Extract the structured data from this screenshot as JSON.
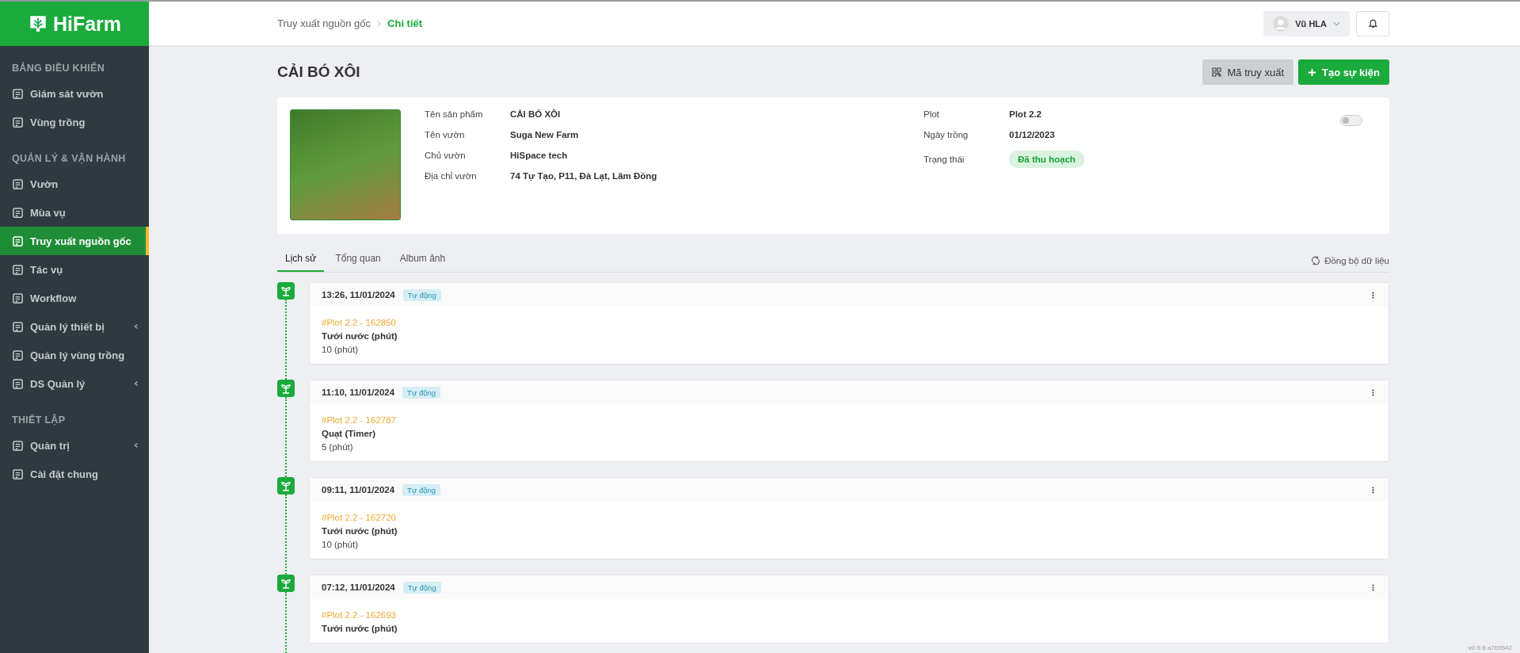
{
  "sidebar": {
    "logo": "HiFarm",
    "sections": [
      {
        "title": "BẢNG ĐIỀU KHIỂN",
        "items": [
          {
            "label": "Giám sát vườn",
            "selected": false,
            "expandable": false
          },
          {
            "label": "Vùng trồng",
            "selected": false,
            "expandable": false
          }
        ]
      },
      {
        "title": "QUẢN LÝ & VẬN HÀNH",
        "items": [
          {
            "label": "Vườn",
            "selected": false,
            "expandable": false
          },
          {
            "label": "Mùa vụ",
            "selected": false,
            "expandable": false
          },
          {
            "label": "Truy xuất nguồn gốc",
            "selected": true,
            "expandable": false
          },
          {
            "label": "Tác vụ",
            "selected": false,
            "expandable": false
          },
          {
            "label": "Workflow",
            "selected": false,
            "expandable": false
          },
          {
            "label": "Quản lý thiết bị",
            "selected": false,
            "expandable": true
          },
          {
            "label": "Quản lý vùng trồng",
            "selected": false,
            "expandable": false
          },
          {
            "label": "DS Quản lý",
            "selected": false,
            "expandable": true
          }
        ]
      },
      {
        "title": "THIẾT LẬP",
        "items": [
          {
            "label": "Quản trị",
            "selected": false,
            "expandable": true
          },
          {
            "label": "Cài đặt chung",
            "selected": false,
            "expandable": false
          }
        ]
      }
    ]
  },
  "header": {
    "breadcrumb": [
      "Truy xuất nguồn gốc",
      "Chi tiết"
    ],
    "user": "Vũ HLA"
  },
  "page": {
    "title": "CẢI BÓ XÔI",
    "buttons": [
      "Mã truy xuất",
      "Tạo sự kiện"
    ]
  },
  "product": {
    "left": [
      {
        "label": "Tên sản phẩm",
        "value": "CẢI BÓ XÔI"
      },
      {
        "label": "Tên vườn",
        "value": "Suga New Farm"
      },
      {
        "label": "Chủ vườn",
        "value": "HiSpace tech"
      },
      {
        "label": "Địa chỉ vườn",
        "value": "74 Tự Tạo, P11, Đà Lạt, Lâm Đồng"
      }
    ],
    "right": [
      {
        "label": "Plot",
        "value": "Plot 2.2"
      },
      {
        "label": "Ngày trồng",
        "value": "01/12/2023"
      }
    ],
    "status": {
      "label": "Trạng thái",
      "value": "Đã thu hoạch"
    },
    "toggle": {
      "on": false
    }
  },
  "tabs": [
    {
      "label": "Lịch sử",
      "selected": true
    },
    {
      "label": "Tổng quan",
      "selected": false
    },
    {
      "label": "Album ảnh",
      "selected": false
    }
  ],
  "sync": "Đồng bộ dữ liệu",
  "events": [
    {
      "time": "13:26, 11/01/2024",
      "tag": "Tự động",
      "ref": "#Plot 2.2 - 162850",
      "action": "Tưới nước (phút)",
      "value": "10 (phút)"
    },
    {
      "time": "11:10, 11/01/2024",
      "tag": "Tự động",
      "ref": "#Plot 2.2 - 162787",
      "action": "Quạt (Timer)",
      "value": "5 (phút)"
    },
    {
      "time": "09:11, 11/01/2024",
      "tag": "Tự động",
      "ref": "#Plot 2.2 - 162720",
      "action": "Tưới nước (phút)",
      "value": "10 (phút)"
    },
    {
      "time": "07:12, 11/01/2024",
      "tag": "Tự động",
      "ref": "#Plot 2.2 - 162693",
      "action": "Tưới nước (phút)"
    }
  ],
  "version": "v0.9.6 a769542"
}
